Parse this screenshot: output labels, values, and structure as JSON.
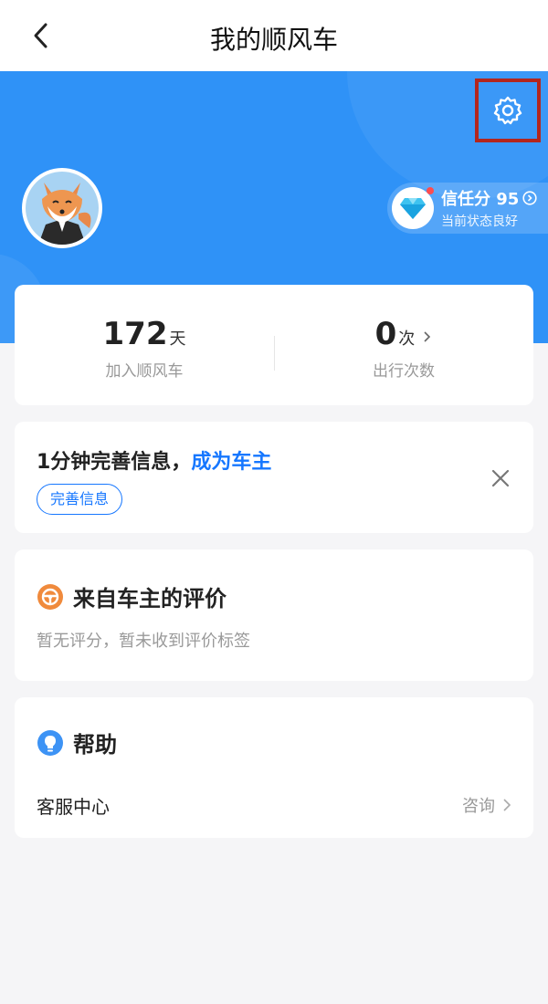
{
  "nav": {
    "title": "我的顺风车"
  },
  "profile": {
    "credit_score_label": "信任分 95",
    "credit_status": "当前状态良好"
  },
  "stats": [
    {
      "value": "172",
      "unit": "天",
      "label": "加入顺风车"
    },
    {
      "value": "0",
      "unit": "次",
      "label": "出行次数"
    }
  ],
  "promo": {
    "text_prefix": "1分钟完善信息，",
    "text_highlight": "成为车主",
    "button": "完善信息"
  },
  "review": {
    "title": "来自车主的评价",
    "subtitle": "暂无评分，暂未收到评价标签"
  },
  "help": {
    "title": "帮助",
    "row_label": "客服中心",
    "row_action": "咨询"
  },
  "colors": {
    "hero": "#2f92f7",
    "accent": "#1677ff",
    "highlight_border": "#b3261e"
  },
  "icons": {
    "back": "chevron-left-icon",
    "settings": "gear-icon",
    "credit": "diamond-icon",
    "review": "steering-wheel-icon",
    "help": "lightbulb-icon"
  }
}
